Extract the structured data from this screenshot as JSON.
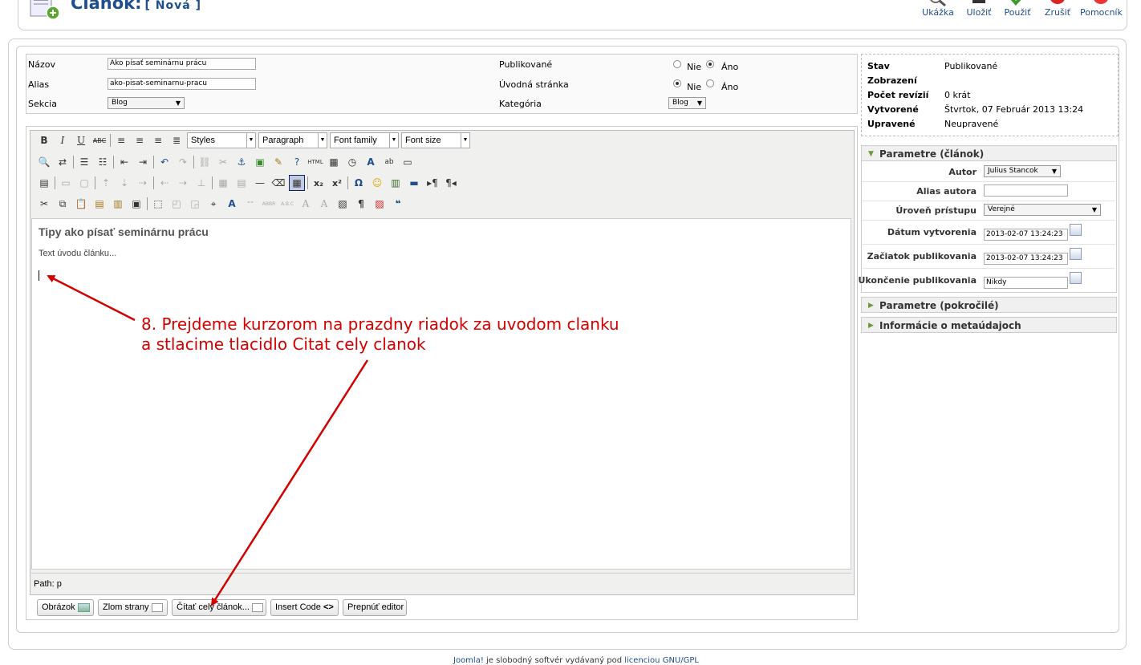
{
  "header": {
    "title": "Článok:",
    "subtitle": "[ Nová ]",
    "toolbar": [
      {
        "label": "Ukážka",
        "icon": "preview-icon"
      },
      {
        "label": "Uložiť",
        "icon": "save-icon"
      },
      {
        "label": "Použiť",
        "icon": "apply-icon"
      },
      {
        "label": "Zrušiť",
        "icon": "cancel-icon"
      },
      {
        "label": "Pomocník",
        "icon": "help-icon"
      }
    ]
  },
  "details": {
    "title_label": "Názov",
    "title_value": "Ako písať seminárnu prácu",
    "alias_label": "Alias",
    "alias_value": "ako-pisat-seminarnu-pracu",
    "section_label": "Sekcia",
    "section_value": "Blog",
    "published_label": "Publikované",
    "frontpage_label": "Úvodná stránka",
    "category_label": "Kategória",
    "category_value": "Blog",
    "no_label": "Nie",
    "yes_label": "Áno",
    "published_selected": "Áno",
    "frontpage_selected": "Nie"
  },
  "editor": {
    "styles_dd": "Styles",
    "format_dd": "Paragraph",
    "font_family_dd": "Font family",
    "font_size_dd": "Font size",
    "heading": "Tipy ako písať seminárnu prácu",
    "intro": "Text úvodu článku...",
    "path": "Path: p"
  },
  "buttons": {
    "image": "Obrázok",
    "pagebreak": "Zlom strany",
    "readmore": "Čítať celý článok...",
    "insert_code": "Insert Code",
    "toggle_editor": "Prepnúť editor"
  },
  "status": {
    "state_label": "Stav",
    "state_value": "Publikované",
    "hits_label": "Zobrazení",
    "revisions_label": "Počet revízií",
    "revisions_value": "0 krát",
    "created_label": "Vytvorené",
    "created_value": "Štvrtok, 07 Február 2013 13:24",
    "modified_label": "Upravené",
    "modified_value": "Neupravené"
  },
  "params": {
    "header": "Parametre (článok)",
    "author_label": "Autor",
    "author_value": "Julius Stancok",
    "alias_author_label": "Alias autora",
    "access_label": "Úroveň prístupu",
    "access_value": "Verejné",
    "created_date_label": "Dátum vytvorenia",
    "created_date_value": "2013-02-07 13:24:23",
    "publish_up_label": "Začiatok publikovania",
    "publish_up_value": "2013-02-07 13:24:23",
    "publish_down_label": "Ukončenie publikovania",
    "publish_down_value": "Nikdy"
  },
  "panels": {
    "advanced": "Parametre (pokročilé)",
    "metadata": "Informácie o metaúdajoch"
  },
  "annotation": {
    "line1": "8. Prejdeme kurzorom na prazdny riadok za uvodom clanku",
    "line2": "a stlacime tlacidlo Citat cely clanok"
  },
  "footer": {
    "link1": "Joomla!",
    "text": " je slobodný softvér vydávaný pod ",
    "link2": "licenciou GNU/GPL"
  },
  "colors": {
    "accent": "#1f4e8c",
    "annotation": "#d40000"
  }
}
